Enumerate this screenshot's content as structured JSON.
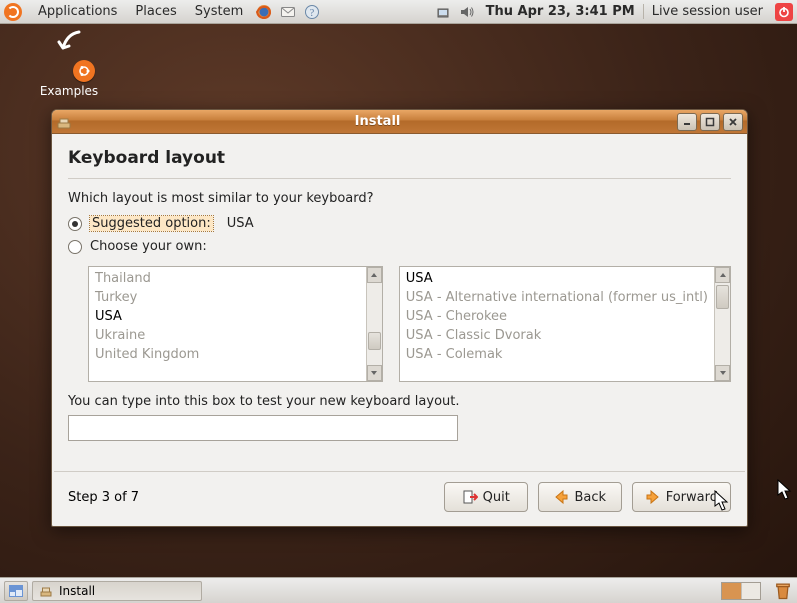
{
  "top_panel": {
    "menus": [
      "Applications",
      "Places",
      "System"
    ],
    "clock": "Thu Apr 23,  3:41 PM",
    "user": "Live session user"
  },
  "desktop": {
    "examples_label": "Examples"
  },
  "window": {
    "title": "Install",
    "page_title": "Keyboard layout",
    "prompt": "Which layout is most similar to your keyboard?",
    "radio_suggested_label": "Suggested option:",
    "suggested_value": "USA",
    "radio_choose_label": "Choose your own:",
    "left_list": [
      "Thailand",
      "Turkey",
      "USA",
      "Ukraine",
      "United Kingdom"
    ],
    "left_selected": "USA",
    "right_list": [
      "USA",
      "USA - Alternative international (former us_intl)",
      "USA - Cherokee",
      "USA - Classic Dvorak",
      "USA - Colemak"
    ],
    "right_selected": "USA",
    "test_label": "You can type into this box to test your new keyboard layout.",
    "test_value": "",
    "step_text": "Step 3 of 7",
    "btn_quit": "Quit",
    "btn_back": "Back",
    "btn_forward": "Forward"
  },
  "bottom_panel": {
    "task_label": "Install"
  }
}
